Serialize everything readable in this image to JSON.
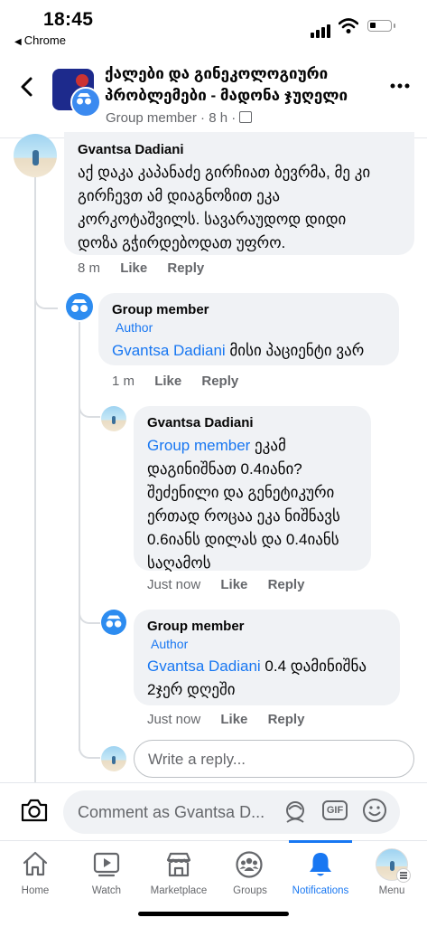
{
  "status_bar": {
    "time": "18:45",
    "back_app": "Chrome"
  },
  "header": {
    "title_line1": "ქალები და გინეკოლოგიური",
    "title_line2": "პრობლემები - მადონა ჯუღელი",
    "subtitle": "Group member · 8 h ·"
  },
  "comments": [
    {
      "name": "Gvantsa Dadiani",
      "lines": [
        "აქ დაკა კაპანაძე გირჩიათ ბევრმა, მე კი",
        "გირჩევთ ამ დიაგნოზით ეკა",
        "კორკოტაშვილს. სავარაუდოდ დიდი",
        "დოზა გჭირდებოდათ უფრო."
      ],
      "time": "8 m",
      "like": "Like",
      "reply": "Reply"
    },
    {
      "name": "Group member",
      "tag": "Author",
      "mention": "Gvantsa Dadiani",
      "text": " მისი პაციენტი ვარ",
      "time": "1 m",
      "like": "Like",
      "reply": "Reply"
    },
    {
      "name": "Gvantsa Dadiani",
      "mention": "Group member",
      "line1_rest": " ეკამ",
      "lines": [
        "დაგინიშნათ 0.4იანი?",
        "შეძენილი და გენეტიკური",
        "ერთად როცაა ეკა ნიშნავს",
        "0.6იანს დილას და 0.4იანს",
        "საღამოს"
      ],
      "time": "Just now",
      "like": "Like",
      "reply": "Reply"
    },
    {
      "name": "Group member",
      "tag": "Author",
      "mention": "Gvantsa Dadiani",
      "text": " 0.4 დამინიშნა",
      "line2": "2ჯერ დღეში",
      "time": "Just now",
      "like": "Like",
      "reply": "Reply"
    }
  ],
  "reply_box": {
    "placeholder": "Write a reply..."
  },
  "composer": {
    "placeholder": "Comment as Gvantsa D...",
    "gif": "GIF"
  },
  "tabs": [
    {
      "label": "Home"
    },
    {
      "label": "Watch"
    },
    {
      "label": "Marketplace"
    },
    {
      "label": "Groups"
    },
    {
      "label": "Notifications"
    },
    {
      "label": "Menu"
    }
  ],
  "colors": {
    "accent": "#1877f2",
    "bubble": "#f0f2f5",
    "secondary_text": "#65676b"
  }
}
